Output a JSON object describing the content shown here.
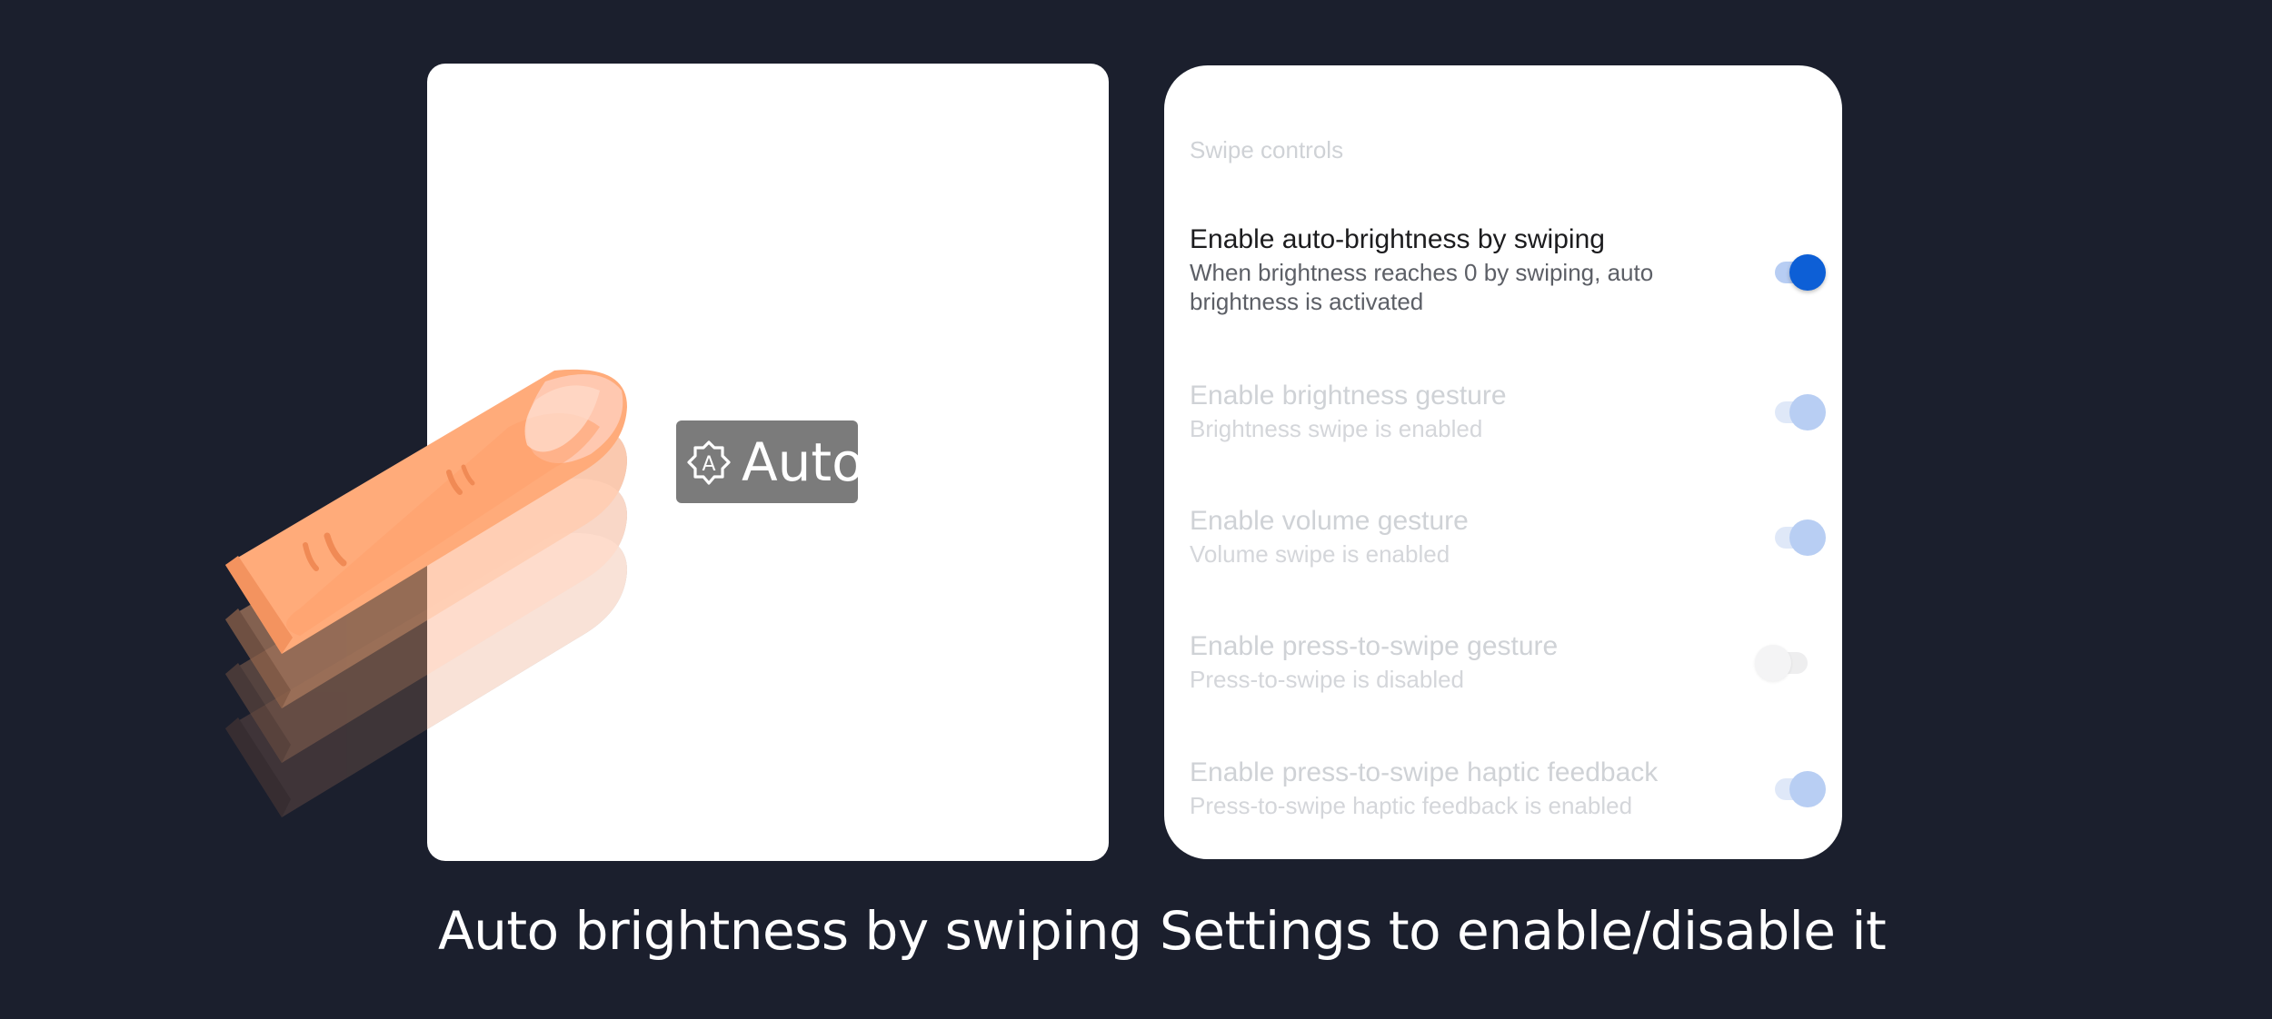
{
  "left_panel": {
    "badge": {
      "icon": "auto-brightness-icon",
      "label": "Auto"
    },
    "caption": "Auto brightness by swiping"
  },
  "right_panel": {
    "section_header": "Swipe controls",
    "settings": [
      {
        "title": "Enable auto-brightness by swiping",
        "subtitle": "When brightness reaches 0 by swiping, auto brightness is activated",
        "toggle_on": true,
        "enabled": true
      },
      {
        "title": "Enable brightness gesture",
        "subtitle": "Brightness swipe is enabled",
        "toggle_on": true,
        "enabled": false
      },
      {
        "title": "Enable volume gesture",
        "subtitle": "Volume swipe is enabled",
        "toggle_on": true,
        "enabled": false
      },
      {
        "title": "Enable press-to-swipe gesture",
        "subtitle": "Press-to-swipe is disabled",
        "toggle_on": false,
        "enabled": false
      },
      {
        "title": "Enable press-to-swipe haptic feedback",
        "subtitle": "Press-to-swipe haptic feedback is enabled",
        "toggle_on": true,
        "enabled": false
      }
    ],
    "caption": "Settings to enable/disable it"
  },
  "colors": {
    "background": "#1b1f2d",
    "accent": "#0d5fd6",
    "finger": "#ffab7a"
  }
}
